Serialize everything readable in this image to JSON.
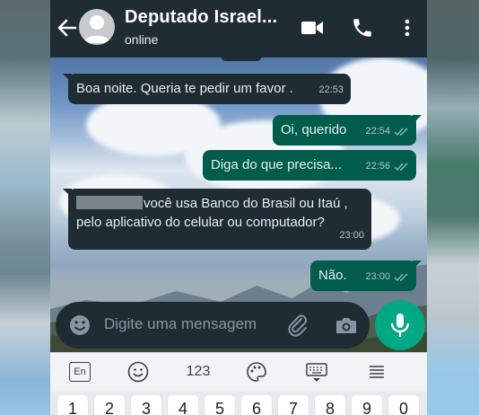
{
  "header": {
    "contact_name": "Deputado Israel...",
    "status": "online"
  },
  "messages": [
    {
      "direction": "incoming",
      "text": "Boa noite. Queria te pedir um favor .",
      "time": "22:53"
    },
    {
      "direction": "outgoing",
      "text": "Oi, querido",
      "time": "22:54",
      "read": true
    },
    {
      "direction": "outgoing",
      "text": "Diga do que precisa...",
      "time": "22:56",
      "read": true
    },
    {
      "direction": "incoming",
      "text_line1": "você usa Banco do Brasil ou Itaú ,",
      "text_line2": "pelo aplicativo do celular ou computador?",
      "time": "23:00",
      "redacted_prefix": true
    },
    {
      "direction": "outgoing",
      "text": "Não.",
      "time": "23:00",
      "read": true
    }
  ],
  "composer": {
    "placeholder": "Digite uma mensagem",
    "icons": [
      "emoji-icon",
      "attach-icon",
      "camera-icon",
      "mic-icon"
    ]
  },
  "keyboard": {
    "toolbar": {
      "lang": "En",
      "numbers": "123"
    },
    "top_row": [
      "1",
      "2",
      "3",
      "4",
      "5",
      "6",
      "7",
      "8",
      "9",
      "0"
    ]
  },
  "colors": {
    "header_bg": "#1f2c34",
    "incoming_bubble": "#1f2c34",
    "outgoing_bubble": "#005c4b",
    "accent": "#00a884",
    "read_ticks": "#8fb8c9"
  }
}
